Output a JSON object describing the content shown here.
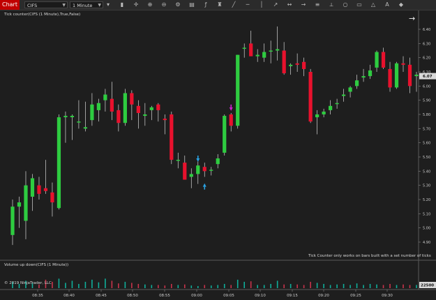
{
  "toolbar": {
    "tab_label": "Chart",
    "instrument": "CIFS",
    "interval": "1 Minute",
    "tools": [
      "dropdown",
      "bars-icon",
      "crosshair-icon",
      "zoom-in-icon",
      "zoom-out-icon",
      "properties-icon",
      "template-icon",
      "indicators-icon",
      "strategies-icon",
      "drawing-line-icon",
      "horizontal-line-icon",
      "vertical-line-icon",
      "ray-icon",
      "extended-line-icon",
      "arrow-line-icon",
      "fibonacci-icon",
      "measure-icon",
      "ellipse-icon",
      "rectangle-icon",
      "triangle-icon",
      "text-icon",
      "marker-icon"
    ]
  },
  "price_panel": {
    "title": "Tick counter(CIFS (1 Minute),True,False)",
    "note": "Tick Counter only works on bars built with a set number of ticks",
    "current_price": "6.07"
  },
  "volume_panel": {
    "title": "Volume up down(CIFS (1 Minute))",
    "copyright": "© 2019 NinjaTrader, LLC",
    "scale_label": "22500"
  },
  "colors": {
    "up": "#2ecc40",
    "down": "#e8112d",
    "current_price_box": "#d9d9d9",
    "vol_up": "#0fae9a",
    "vol_down": "#c8334b"
  },
  "chart_data": {
    "type": "candlestick",
    "y_axis": {
      "min": 4.8,
      "max": 6.4,
      "ticks": [
        "6.40",
        "6.30",
        "6.20",
        "6.10",
        "6.00",
        "5.90",
        "5.80",
        "5.70",
        "5.60",
        "5.50",
        "5.40",
        "5.30",
        "5.20",
        "5.10",
        "5.00",
        "4.90"
      ]
    },
    "x_ticks": [
      "08:35",
      "08:40",
      "08:45",
      "08:50",
      "08:55",
      "09:00",
      "09:05",
      "09:10",
      "09:15",
      "09:20",
      "09:25",
      "09:30"
    ],
    "candles": [
      {
        "o": 4.95,
        "h": 5.2,
        "l": 4.88,
        "c": 5.15
      },
      {
        "o": 5.15,
        "h": 5.22,
        "l": 5.0,
        "c": 5.18
      },
      {
        "o": 5.05,
        "h": 5.4,
        "l": 4.92,
        "c": 5.3
      },
      {
        "o": 5.22,
        "h": 5.38,
        "l": 5.12,
        "c": 5.35
      },
      {
        "o": 5.3,
        "h": 5.36,
        "l": 5.2,
        "c": 5.24
      },
      {
        "o": 5.28,
        "h": 5.48,
        "l": 5.24,
        "c": 5.26
      },
      {
        "o": 5.25,
        "h": 5.32,
        "l": 5.08,
        "c": 5.18
      },
      {
        "o": 5.14,
        "h": 5.8,
        "l": 5.13,
        "c": 5.78
      },
      {
        "o": 5.78,
        "h": 5.82,
        "l": 5.6,
        "c": 5.79
      },
      {
        "o": 5.78,
        "h": 5.8,
        "l": 5.62,
        "c": 5.79
      },
      {
        "o": 5.75,
        "h": 5.9,
        "l": 5.7,
        "c": 5.75
      },
      {
        "o": 5.7,
        "h": 5.89,
        "l": 5.68,
        "c": 5.71
      },
      {
        "o": 5.76,
        "h": 5.95,
        "l": 5.72,
        "c": 5.87
      },
      {
        "o": 5.83,
        "h": 5.91,
        "l": 5.75,
        "c": 5.88
      },
      {
        "o": 5.9,
        "h": 5.98,
        "l": 5.82,
        "c": 5.94
      },
      {
        "o": 5.91,
        "h": 6.03,
        "l": 5.76,
        "c": 5.82
      },
      {
        "o": 5.83,
        "h": 5.87,
        "l": 5.68,
        "c": 5.74
      },
      {
        "o": 5.74,
        "h": 5.98,
        "l": 5.72,
        "c": 5.95
      },
      {
        "o": 5.95,
        "h": 5.97,
        "l": 5.76,
        "c": 5.87
      },
      {
        "o": 5.86,
        "h": 5.9,
        "l": 5.7,
        "c": 5.81
      },
      {
        "o": 5.79,
        "h": 5.88,
        "l": 5.72,
        "c": 5.8
      },
      {
        "o": 5.83,
        "h": 5.86,
        "l": 5.76,
        "c": 5.85
      },
      {
        "o": 5.87,
        "h": 5.88,
        "l": 5.75,
        "c": 5.83
      },
      {
        "o": 5.77,
        "h": 5.8,
        "l": 5.66,
        "c": 5.76
      },
      {
        "o": 5.8,
        "h": 5.82,
        "l": 5.45,
        "c": 5.48
      },
      {
        "o": 5.48,
        "h": 5.53,
        "l": 5.42,
        "c": 5.48
      },
      {
        "o": 5.46,
        "h": 5.51,
        "l": 5.34,
        "c": 5.34
      },
      {
        "o": 5.36,
        "h": 5.42,
        "l": 5.28,
        "c": 5.38
      },
      {
        "o": 5.38,
        "h": 5.47,
        "l": 5.31,
        "c": 5.44
      },
      {
        "o": 5.43,
        "h": 5.46,
        "l": 5.36,
        "c": 5.4
      },
      {
        "o": 5.41,
        "h": 5.43,
        "l": 5.37,
        "c": 5.41
      },
      {
        "o": 5.45,
        "h": 5.52,
        "l": 5.42,
        "c": 5.49
      },
      {
        "o": 5.53,
        "h": 5.8,
        "l": 5.51,
        "c": 5.79
      },
      {
        "o": 5.8,
        "h": 5.81,
        "l": 5.68,
        "c": 5.72
      },
      {
        "o": 5.72,
        "h": 6.22,
        "l": 5.7,
        "c": 6.22
      },
      {
        "o": 6.27,
        "h": 6.3,
        "l": 6.2,
        "c": 6.27
      },
      {
        "o": 6.3,
        "h": 6.39,
        "l": 6.22,
        "c": 6.21
      },
      {
        "o": 6.21,
        "h": 6.26,
        "l": 6.17,
        "c": 6.22
      },
      {
        "o": 6.2,
        "h": 6.3,
        "l": 6.17,
        "c": 6.24
      },
      {
        "o": 6.25,
        "h": 6.32,
        "l": 6.16,
        "c": 6.25
      },
      {
        "o": 6.25,
        "h": 6.42,
        "l": 6.18,
        "c": 6.26
      },
      {
        "o": 6.25,
        "h": 6.31,
        "l": 6.08,
        "c": 6.09
      },
      {
        "o": 6.14,
        "h": 6.16,
        "l": 6.08,
        "c": 6.15
      },
      {
        "o": 6.16,
        "h": 6.23,
        "l": 6.1,
        "c": 6.15
      },
      {
        "o": 6.17,
        "h": 6.2,
        "l": 6.07,
        "c": 6.12
      },
      {
        "o": 6.1,
        "h": 6.12,
        "l": 5.74,
        "c": 5.75
      },
      {
        "o": 5.78,
        "h": 5.83,
        "l": 5.66,
        "c": 5.8
      },
      {
        "o": 5.8,
        "h": 5.84,
        "l": 5.78,
        "c": 5.82
      },
      {
        "o": 5.83,
        "h": 5.9,
        "l": 5.8,
        "c": 5.86
      },
      {
        "o": 5.88,
        "h": 5.91,
        "l": 5.84,
        "c": 5.88
      },
      {
        "o": 5.93,
        "h": 5.98,
        "l": 5.89,
        "c": 5.94
      },
      {
        "o": 5.96,
        "h": 6.0,
        "l": 5.92,
        "c": 5.99
      },
      {
        "o": 6.0,
        "h": 6.08,
        "l": 5.98,
        "c": 6.04
      },
      {
        "o": 6.06,
        "h": 6.12,
        "l": 6.03,
        "c": 6.07
      },
      {
        "o": 6.07,
        "h": 6.15,
        "l": 6.05,
        "c": 6.11
      },
      {
        "o": 6.13,
        "h": 6.25,
        "l": 6.1,
        "c": 6.24
      },
      {
        "o": 6.24,
        "h": 6.27,
        "l": 6.12,
        "c": 6.13
      },
      {
        "o": 6.12,
        "h": 6.17,
        "l": 5.96,
        "c": 5.99
      },
      {
        "o": 5.99,
        "h": 6.17,
        "l": 5.98,
        "c": 6.16
      },
      {
        "o": 6.16,
        "h": 6.21,
        "l": 6.1,
        "c": 6.15
      },
      {
        "o": 6.15,
        "h": 6.2,
        "l": 5.95,
        "c": 6.0
      },
      {
        "o": 6.07,
        "h": 6.1,
        "l": 5.96,
        "c": 6.08
      }
    ],
    "markers": [
      {
        "bar": 28,
        "price": 5.49,
        "type": "down-arrow",
        "color": "#2aa0e0"
      },
      {
        "bar": 29,
        "price": 5.29,
        "type": "up-arrow",
        "color": "#2aa0e0"
      },
      {
        "bar": 33,
        "price": 5.85,
        "type": "down-arrow",
        "color": "#d020d0"
      }
    ],
    "volume": {
      "max": 22500,
      "values": [
        6000,
        4000,
        7000,
        5000,
        3500,
        8000,
        6000,
        9000,
        5000,
        7000,
        4000,
        6000,
        8000,
        5500,
        9000,
        7000,
        4500,
        6000,
        5000,
        4000,
        3500,
        3000,
        3000,
        2500,
        4000,
        3000,
        3500,
        2500,
        2000,
        3000,
        2500,
        3000,
        4000,
        3000,
        8000,
        6000,
        6500,
        3000,
        3000,
        4000,
        7000,
        3500,
        4000,
        3500,
        3000,
        6000,
        5000,
        4000,
        3000,
        3500,
        4000,
        3000,
        4500,
        3000,
        4000,
        3500,
        3000,
        4000,
        3000,
        3500,
        3000,
        3000
      ]
    }
  }
}
